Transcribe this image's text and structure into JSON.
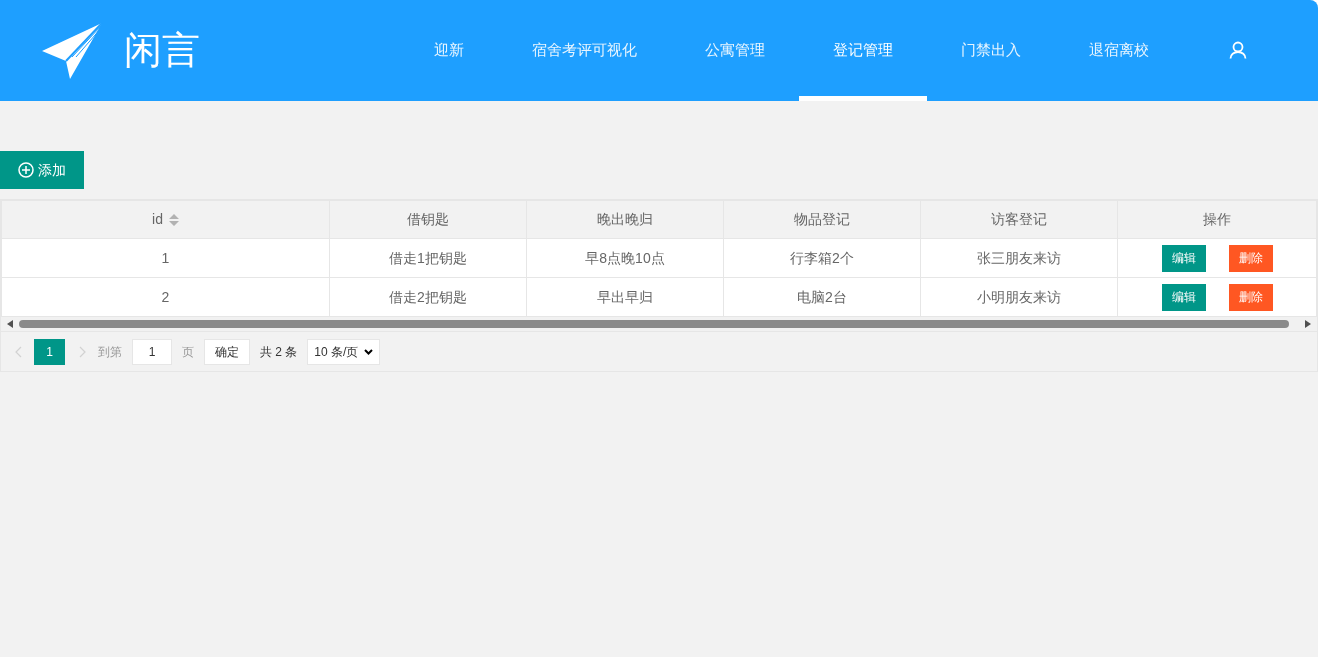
{
  "header": {
    "logo_text": "闲言",
    "nav": [
      {
        "label": "迎新",
        "selected": false
      },
      {
        "label": "宿舍考评可视化",
        "selected": false
      },
      {
        "label": "公寓管理",
        "selected": false
      },
      {
        "label": "登记管理",
        "selected": true
      },
      {
        "label": "门禁出入",
        "selected": false
      },
      {
        "label": "退宿离校",
        "selected": false
      }
    ]
  },
  "add_button": "添加",
  "table": {
    "columns": [
      "id",
      "借钥匙",
      "晚出晚归",
      "物品登记",
      "访客登记",
      "操作"
    ],
    "rows": [
      {
        "cells": [
          "1",
          "借走1把钥匙",
          "早8点晚10点",
          "行李箱2个",
          "张三朋友来访"
        ],
        "actions": [
          "编辑",
          "删除"
        ]
      },
      {
        "cells": [
          "2",
          "借走2把钥匙",
          "早出早归",
          "电脑2台",
          "小明朋友来访"
        ],
        "actions": [
          "编辑",
          "删除"
        ]
      }
    ]
  },
  "pagination": {
    "pages": [
      {
        "label": "1",
        "selected": true
      }
    ],
    "goto_label": "到第",
    "goto_value": "1",
    "page_unit": "页",
    "confirm": "确定",
    "total": "共 2 条",
    "page_size": "10 条/页"
  }
}
